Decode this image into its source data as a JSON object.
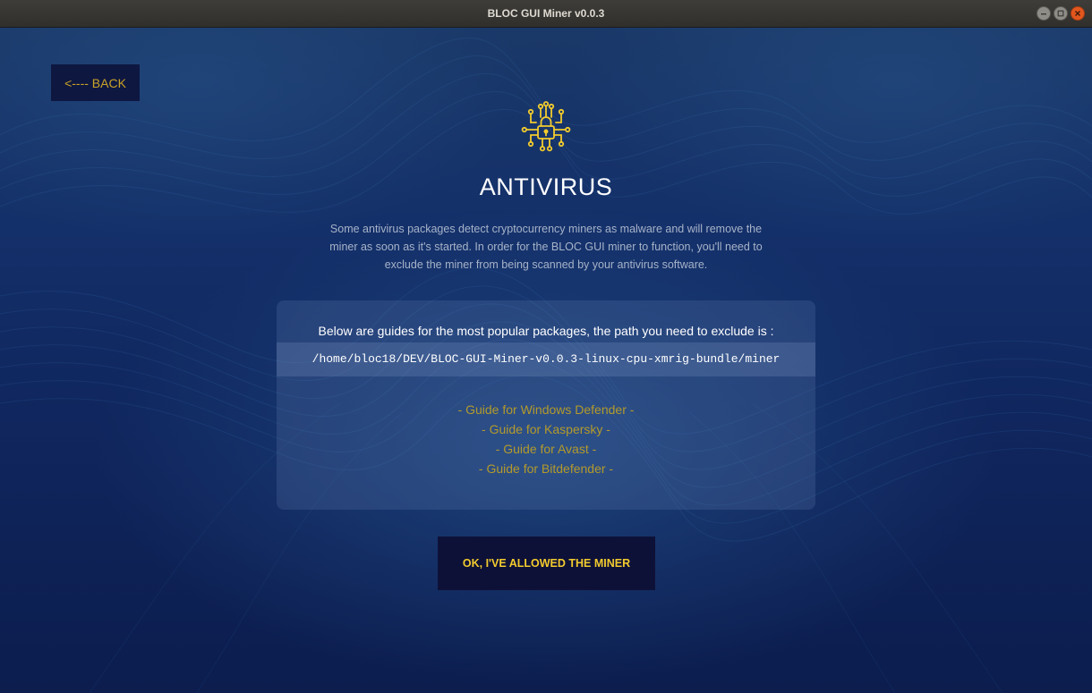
{
  "window": {
    "title": "BLOC GUI Miner v0.0.3",
    "controls": [
      "minimize-icon",
      "maximize-icon",
      "close-icon"
    ]
  },
  "nav": {
    "back_label": "<---- BACK"
  },
  "header": {
    "icon": "circuit-lock-icon",
    "title": "ANTIVIRUS",
    "description": "Some antivirus packages detect cryptocurrency miners as malware and will remove the miner as soon as it's started. In order for the BLOC GUI miner to function, you'll need to exclude the miner from being scanned by your antivirus software."
  },
  "panel": {
    "intro": "Below are guides for the most popular packages, the path you need to exclude is :",
    "path": "/home/bloc18/DEV/BLOC-GUI-Miner-v0.0.3-linux-cpu-xmrig-bundle/miner",
    "guides": [
      {
        "label": "- Guide for Windows Defender -"
      },
      {
        "label": "- Guide for Kaspersky -"
      },
      {
        "label": "- Guide for Avast -"
      },
      {
        "label": "- Guide for Bitdefender -"
      }
    ]
  },
  "actions": {
    "confirm_label": "OK, I'VE ALLOWED THE MINER"
  },
  "colors": {
    "accent": "#f2cb2e",
    "link": "#b39a2b",
    "background": "#10275f",
    "button_bg": "#0e1137"
  }
}
